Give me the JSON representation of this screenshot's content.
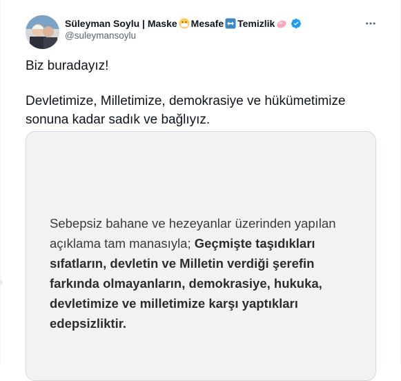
{
  "tweet": {
    "author": {
      "name_part1": "Süleyman Soylu | Maske",
      "name_part2": "Mesafe",
      "name_part3": "Temizlik",
      "handle": "@suleymansoylu",
      "verified": true
    },
    "text": {
      "line1": "Biz buradayız!",
      "line2": "Devletimize, Milletimize, demokrasiye ve hükümetimize sonuna kadar sadık ve bağlıyız."
    },
    "media": {
      "statement_regular": "Sebepsiz bahane ve hezeyanlar üzerinden yapılan açıklama tam manasıyla;",
      "statement_bold": "Geçmişte taşıdıkları sıfatların, devletin ve Milletin verdiği şerefin farkında olmayanların, demokrasiye, hukuka, devletimize ve milletimize karşı yaptıkları edepsizliktir."
    }
  },
  "colors": {
    "text_primary": "#0f1419",
    "text_secondary": "#536471",
    "verified_blue": "#1d9bf0",
    "border": "#cfd9de",
    "media_background": "#f2f2f4"
  },
  "icons": {
    "mask_emoji": "face-with-medical-mask-icon",
    "distance_emoji": "left-right-arrow-icon",
    "clean_emoji": "soap-icon",
    "verified": "verified-badge-icon",
    "more": "more-options-icon"
  }
}
